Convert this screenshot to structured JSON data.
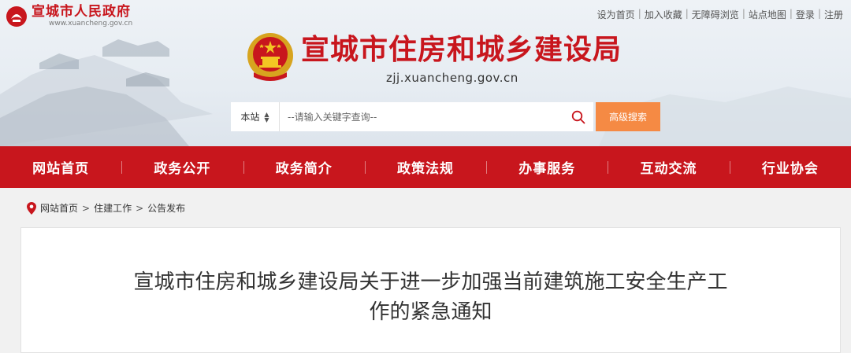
{
  "gov": {
    "name": "宣城市人民政府",
    "url": "www.xuancheng.gov.cn"
  },
  "toplinks": [
    "设为首页",
    "加入收藏",
    "无障碍浏览",
    "站点地图",
    "登录",
    "注册"
  ],
  "site": {
    "name": "宣城市住房和城乡建设局",
    "domain": "zjj.xuancheng.gov.cn"
  },
  "search": {
    "scope": "本站",
    "placeholder": "--请输入关键字查询--",
    "advanced_label": "高级搜索"
  },
  "nav": [
    "网站首页",
    "政务公开",
    "政务简介",
    "政策法规",
    "办事服务",
    "互动交流",
    "行业协会"
  ],
  "breadcrumb": [
    "网站首页",
    "住建工作",
    "公告发布"
  ],
  "article": {
    "title_line1": "宣城市住房和城乡建设局关于进一步加强当前建筑施工安全生产工",
    "title_line2": "作的紧急通知"
  },
  "colors": {
    "brand_red": "#c8161d",
    "search_orange": "#f58a44"
  },
  "icons": [
    "national-emblem-icon",
    "search-icon",
    "location-pin-icon",
    "sort-arrows-icon"
  ]
}
